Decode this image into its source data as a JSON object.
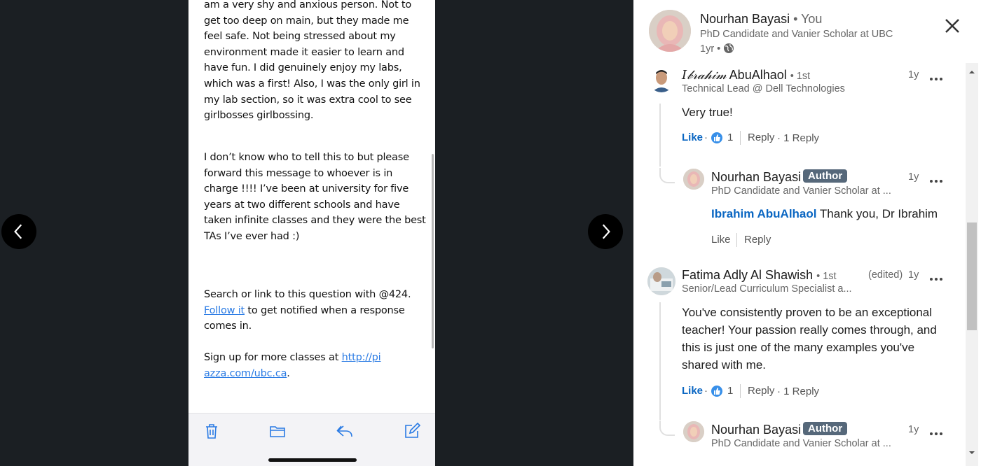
{
  "viewer": {
    "message_paragraphs": [
      "am a very shy and anxious person. Not to get too deep on main, but they made me feel safe. Not being stressed about my environment made it easier to learn and have fun. I did genuinely enjoy my labs, which was a first! Also, I was the only girl in my lab section, so it was extra cool to see girlbosses girlbossing.",
      "I don’t know who to tell this to but please forward this message to whoever is in charge !!!! I’ve been at university for five years at two different schools and have taken infinite classes and they were the best TAs I’ve ever had :)"
    ],
    "search_line": "Search or link to this question with @424.",
    "follow_link": "Follow it",
    "follow_rest": " to get notified when a response comes in.",
    "signup_text": "Sign up for more classes at ",
    "signup_link": "http://piazza.com/ubc.ca",
    "signup_end": ".",
    "toolbar": [
      "trash-icon",
      "folder-icon",
      "reply-icon",
      "compose-icon"
    ]
  },
  "post": {
    "author": "Nourhan Bayasi",
    "you": "• You",
    "headline": "PhD Candidate and Vanier Scholar at UBC",
    "time": "1yr •"
  },
  "comments": [
    {
      "name_script": "𝐼𝒷𝓇𝒶𝒽𝒾𝓂",
      "name_rest": "AbuAlhaol",
      "degree": "• 1st",
      "headline": "Technical Lead @ Dell Technologies",
      "time": "1y",
      "text": "Very true!",
      "like": "Like",
      "dot": "·",
      "reactions": "1",
      "reply": "Reply",
      "replies": "· 1 Reply",
      "reply_item": {
        "name": "Nourhan Bayasi",
        "badge": "Author",
        "headline": "PhD Candidate and Vanier Scholar at ...",
        "time": "1y",
        "mention": "Ibrahim AbuAlhaol",
        "text": " Thank you, Dr Ibrahim",
        "like": "Like",
        "reply": "Reply"
      }
    },
    {
      "name": "Fatima Adly Al Shawish",
      "degree": "• 1st",
      "edited": "(edited)",
      "headline": "Senior/Lead Curriculum Specialist a...",
      "time": "1y",
      "text_lines": [
        "You've consistently proven to be an exceptional",
        "teacher! Your passion really comes through, and",
        "this is just one of the many examples you've",
        "shared with me."
      ],
      "like": "Like",
      "dot": "·",
      "reactions": "1",
      "reply": "Reply",
      "replies": "· 1 Reply",
      "reply_item": {
        "name": "Nourhan Bayasi",
        "badge": "Author",
        "headline": "PhD Candidate and Vanier Scholar at ...",
        "time": "1y"
      }
    }
  ],
  "colors": {
    "link": "#0a66c2",
    "badge": "#56687a",
    "backdrop": "#1b1f23"
  }
}
